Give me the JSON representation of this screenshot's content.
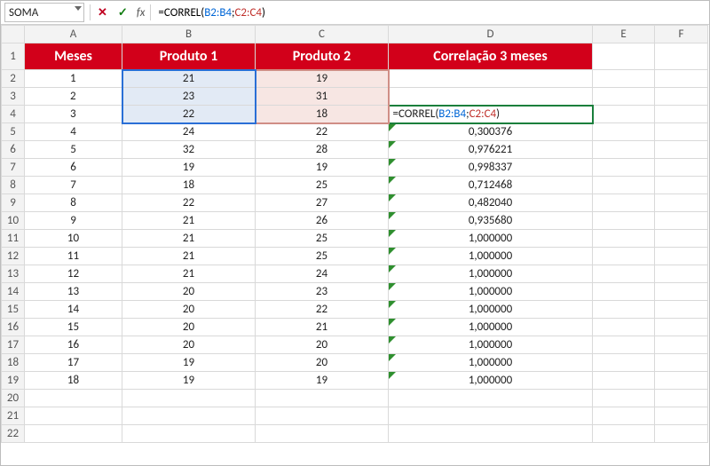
{
  "formula_bar": {
    "name_box": "SOMA",
    "cancel_glyph": "✕",
    "enter_glyph": "✓",
    "fx_label": "fx",
    "formula_prefix": "=CORREL(",
    "range1": "B2:B4",
    "sep": ";",
    "range2": "C2:C4",
    "formula_suffix": ")"
  },
  "columns": [
    "A",
    "B",
    "C",
    "D",
    "E",
    "F"
  ],
  "header": {
    "A": "Meses",
    "B": "Produto 1",
    "C": "Produto 2",
    "D": "Correlação 3 meses"
  },
  "active_cell_text_prefix": "=CORREL(",
  "active_cell_r1": "B2:B4",
  "active_cell_sep": ";",
  "active_cell_r2": "C2:C4",
  "active_cell_suffix": ")",
  "rows": [
    {
      "n": "1",
      "A": "1",
      "B": "21",
      "C": "19",
      "D": ""
    },
    {
      "n": "2",
      "A": "2",
      "B": "23",
      "C": "31",
      "D": ""
    },
    {
      "n": "3",
      "A": "3",
      "B": "22",
      "C": "18",
      "D_formula": true
    },
    {
      "n": "4",
      "A": "4",
      "B": "24",
      "C": "22",
      "D": "0,300376",
      "tri": true
    },
    {
      "n": "5",
      "A": "5",
      "B": "32",
      "C": "28",
      "D": "0,976221",
      "tri": true
    },
    {
      "n": "6",
      "A": "6",
      "B": "19",
      "C": "19",
      "D": "0,998337",
      "tri": true
    },
    {
      "n": "7",
      "A": "7",
      "B": "18",
      "C": "25",
      "D": "0,712468",
      "tri": true
    },
    {
      "n": "8",
      "A": "8",
      "B": "22",
      "C": "27",
      "D": "0,482040",
      "tri": true
    },
    {
      "n": "9",
      "A": "9",
      "B": "21",
      "C": "26",
      "D": "0,935680",
      "tri": true
    },
    {
      "n": "10",
      "A": "10",
      "B": "21",
      "C": "25",
      "D": "1,000000",
      "tri": true
    },
    {
      "n": "11",
      "A": "11",
      "B": "21",
      "C": "25",
      "D": "1,000000",
      "tri": true
    },
    {
      "n": "12",
      "A": "12",
      "B": "21",
      "C": "24",
      "D": "1,000000",
      "tri": true
    },
    {
      "n": "13",
      "A": "13",
      "B": "20",
      "C": "23",
      "D": "1,000000",
      "tri": true
    },
    {
      "n": "14",
      "A": "14",
      "B": "20",
      "C": "22",
      "D": "1,000000",
      "tri": true
    },
    {
      "n": "15",
      "A": "15",
      "B": "20",
      "C": "21",
      "D": "1,000000",
      "tri": true
    },
    {
      "n": "16",
      "A": "16",
      "B": "20",
      "C": "20",
      "D": "1,000000",
      "tri": true
    },
    {
      "n": "17",
      "A": "17",
      "B": "19",
      "C": "20",
      "D": "1,000000",
      "tri": true
    },
    {
      "n": "18",
      "A": "18",
      "B": "19",
      "C": "19",
      "D": "1,000000",
      "tri": true
    },
    {
      "n": "19",
      "A": "",
      "B": "",
      "C": "",
      "D": ""
    },
    {
      "n": "20",
      "A": "",
      "B": "",
      "C": "",
      "D": ""
    },
    {
      "n": "21",
      "A": "",
      "B": "",
      "C": "",
      "D": ""
    }
  ]
}
